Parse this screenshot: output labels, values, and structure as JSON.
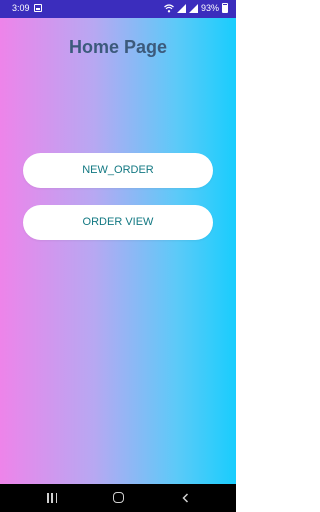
{
  "status_bar": {
    "time": "3:09",
    "battery": "93%",
    "icons": [
      "gallery-icon",
      "wifi-icon",
      "signal-icon",
      "signal-icon",
      "battery-icon"
    ]
  },
  "header": {
    "title": "Home Page"
  },
  "main": {
    "buttons": [
      {
        "label": "NEW_ORDER"
      },
      {
        "label": "ORDER VIEW"
      }
    ]
  },
  "nav_bar": {
    "icons": [
      "recent-apps-icon",
      "home-icon",
      "back-icon"
    ]
  },
  "colors": {
    "status_bar": "#3b2dbd",
    "gradient_left": "#ee84ea",
    "gradient_right": "#19cdfd",
    "title": "#3c5a7c",
    "button_text": "#127882",
    "button_bg": "#ffffff",
    "nav_bar": "#000000"
  }
}
